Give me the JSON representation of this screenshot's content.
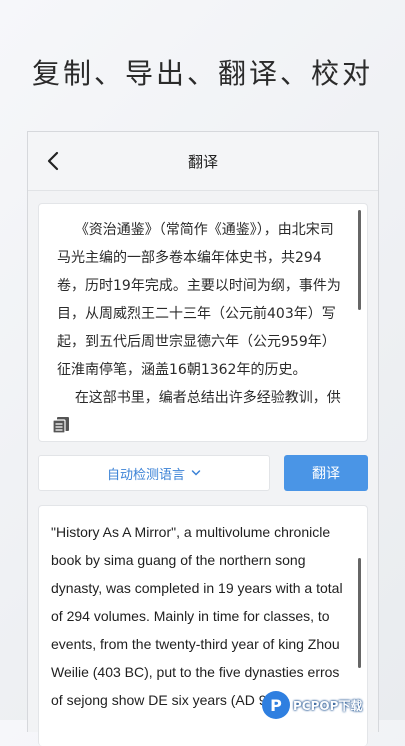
{
  "headline": "复制、导出、翻译、校对",
  "navbar": {
    "title": "翻译",
    "back_icon": "chevron-left-icon"
  },
  "source": {
    "text": "    《资治通鉴》（常简作《通鉴》），由北宋司马光主编的一部多卷本编年体史书，共294卷，历时19年完成。主要以时间为纲，事件为目，从周威烈王二十三年（公元前403年）写起，到五代后周世宗显德六年（公元959年）征淮南停笔，涵盖16朝1362年的历史。\n    在这部书里，编者总结出许多经验教训，供",
    "copy_icon": "copy-icon"
  },
  "controls": {
    "language_label": "自动检测语言",
    "language_icon": "chevron-down-icon",
    "translate_label": "翻译"
  },
  "output": {
    "text": "\"History As A Mirror\", a multivolume chronicle book by sima guang of the northern song dynasty, was completed in 19 years with a total of 294 volumes. Mainly in time for classes, to events, from the twenty-third year of king Zhou Weilie (403 BC), put to the five dynasties erros of sejong show DE six years (AD 959)"
  },
  "watermark": {
    "logo_letter": "P",
    "text": "PCPOP下载"
  },
  "colors": {
    "accent": "#4a95e6",
    "link": "#3b82d6"
  }
}
